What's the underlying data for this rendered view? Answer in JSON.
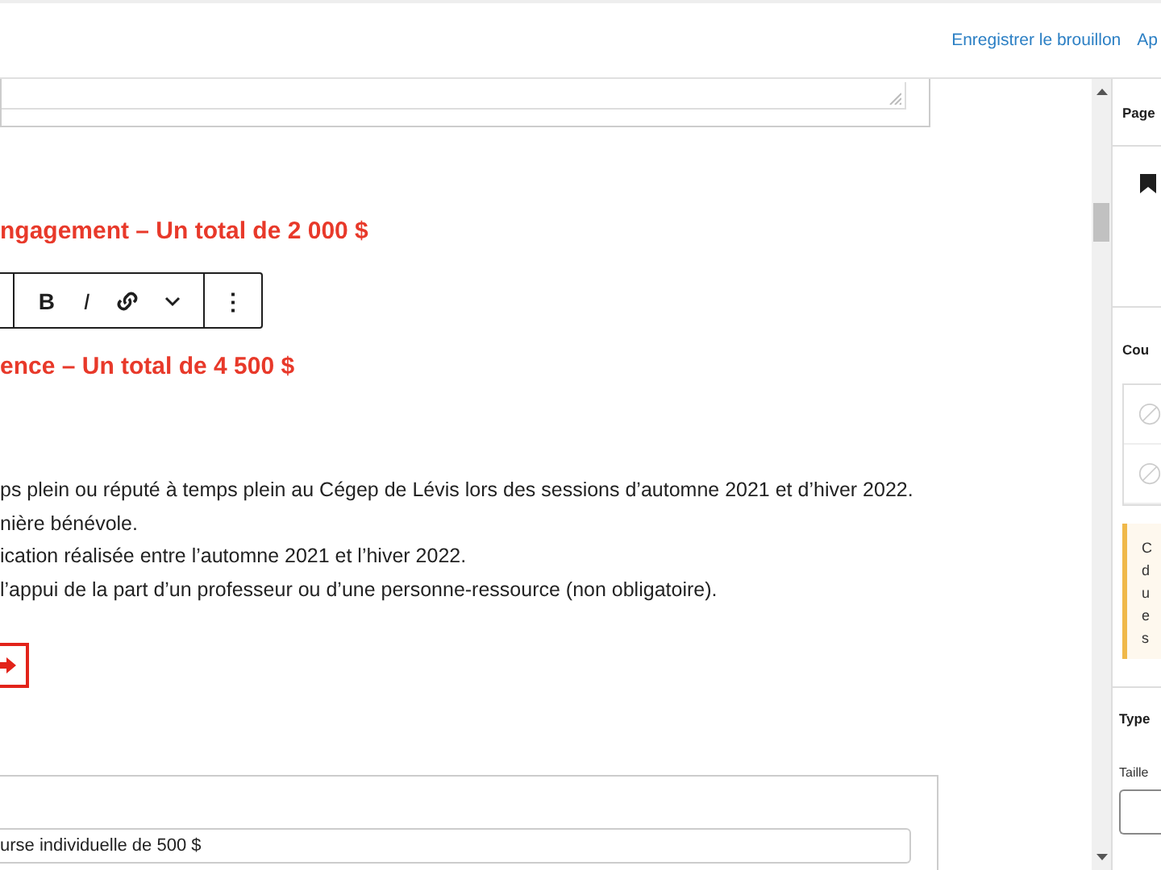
{
  "header": {
    "actions": [
      "Enregistrer le brouillon",
      "Ap"
    ]
  },
  "editor": {
    "headings": [
      "ngagement – Un total de 2 000 $",
      "ence – Un total de 4 500 $"
    ],
    "toolbar": {
      "bold": "B",
      "italic": "I",
      "more": "⋮"
    },
    "list": [
      "ps plein ou réputé à temps plein au Cégep de Lévis lors des sessions d’automne 2021 et d’hiver 2022.",
      "nière bénévole.",
      "ication réalisée entre l’automne 2021 et l’hiver 2022.",
      "l’appui de la part d’un professeur ou d’une personne-ressource (non obligatoire)."
    ],
    "field_value": "urse individuelle de 500 $"
  },
  "sidebar": {
    "tab": "Page",
    "section_1": "Cou",
    "notice_lines": [
      "C",
      "d",
      "u",
      "e",
      "s"
    ],
    "section_2": "Type",
    "size_label": "Taille"
  }
}
